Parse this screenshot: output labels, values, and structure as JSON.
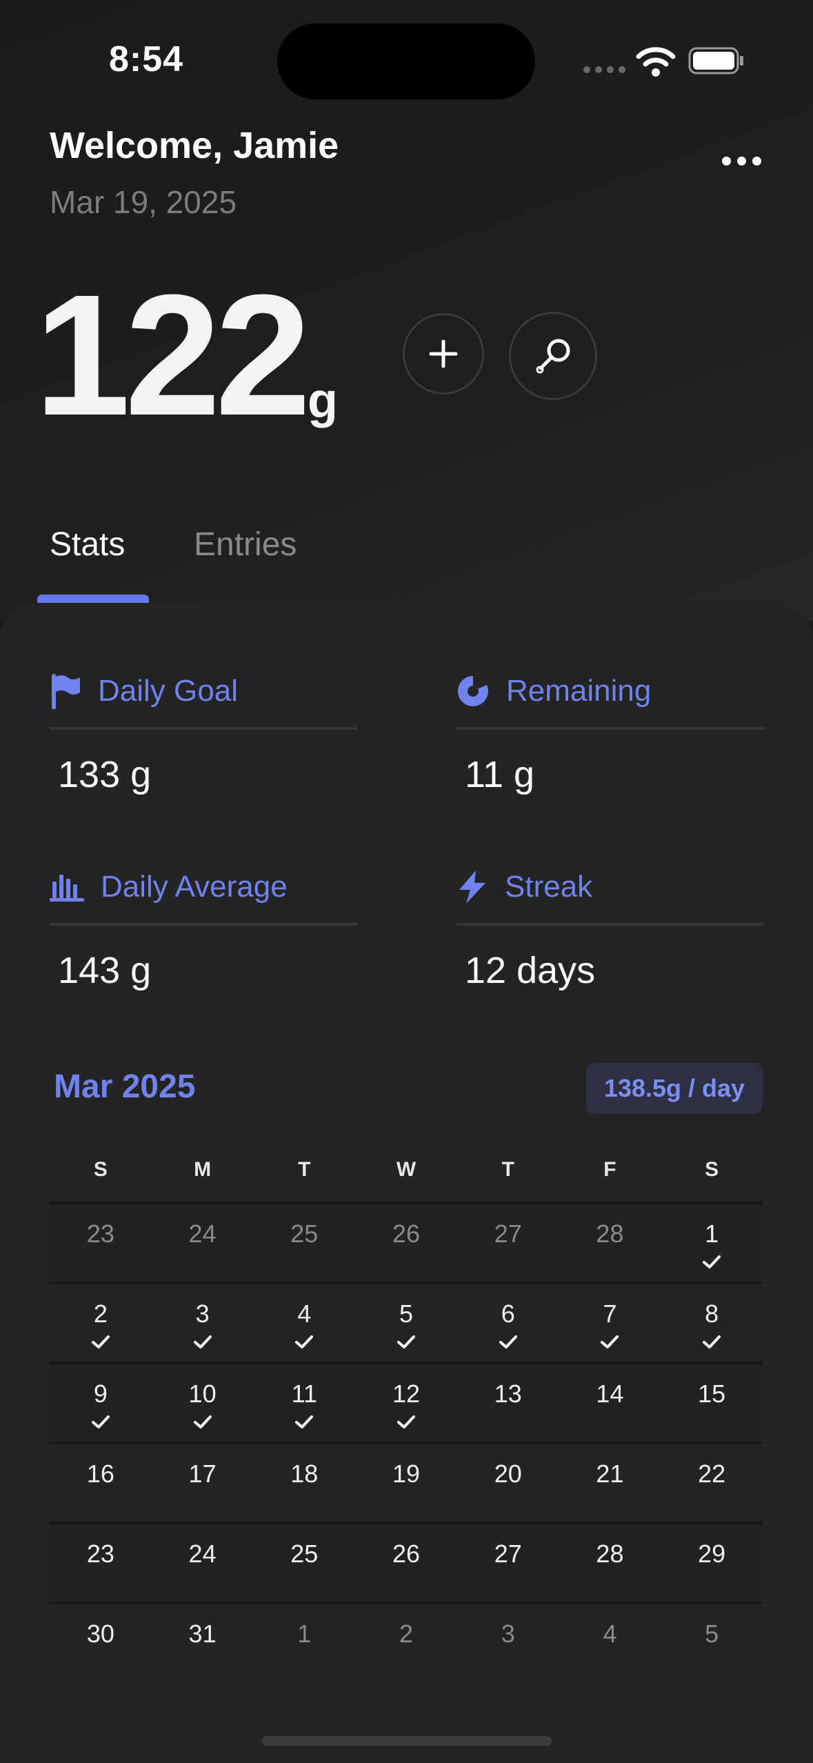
{
  "status_bar": {
    "time": "8:54"
  },
  "header": {
    "welcome": "Welcome, Jamie",
    "date": "Mar 19, 2025"
  },
  "total": {
    "value": "122",
    "unit": "g"
  },
  "tabs": [
    {
      "label": "Stats",
      "active": true
    },
    {
      "label": "Entries",
      "active": false
    }
  ],
  "stats": [
    {
      "label": "Daily Goal",
      "value": "133 g",
      "icon": "flag-icon"
    },
    {
      "label": "Remaining",
      "value": "11 g",
      "icon": "pie-icon"
    },
    {
      "label": "Daily Average",
      "value": "143 g",
      "icon": "bar-chart-icon"
    },
    {
      "label": "Streak",
      "value": "12 days",
      "icon": "lightning-icon"
    }
  ],
  "calendar": {
    "month": "Mar 2025",
    "badge": "138.5g / day",
    "weekdays": [
      "S",
      "M",
      "T",
      "W",
      "T",
      "F",
      "S"
    ],
    "weeks": [
      [
        {
          "d": "23",
          "muted": true
        },
        {
          "d": "24",
          "muted": true
        },
        {
          "d": "25",
          "muted": true
        },
        {
          "d": "26",
          "muted": true
        },
        {
          "d": "27",
          "muted": true
        },
        {
          "d": "28",
          "muted": true
        },
        {
          "d": "1",
          "check": true
        }
      ],
      [
        {
          "d": "2",
          "check": true
        },
        {
          "d": "3",
          "check": true
        },
        {
          "d": "4",
          "check": true
        },
        {
          "d": "5",
          "check": true
        },
        {
          "d": "6",
          "check": true
        },
        {
          "d": "7",
          "check": true
        },
        {
          "d": "8",
          "check": true
        }
      ],
      [
        {
          "d": "9",
          "check": true
        },
        {
          "d": "10",
          "check": true
        },
        {
          "d": "11",
          "check": true
        },
        {
          "d": "12",
          "check": true
        },
        {
          "d": "13"
        },
        {
          "d": "14"
        },
        {
          "d": "15"
        }
      ],
      [
        {
          "d": "16"
        },
        {
          "d": "17"
        },
        {
          "d": "18"
        },
        {
          "d": "19"
        },
        {
          "d": "20"
        },
        {
          "d": "21"
        },
        {
          "d": "22"
        }
      ],
      [
        {
          "d": "23"
        },
        {
          "d": "24"
        },
        {
          "d": "25"
        },
        {
          "d": "26"
        },
        {
          "d": "27"
        },
        {
          "d": "28"
        },
        {
          "d": "29"
        }
      ],
      [
        {
          "d": "30"
        },
        {
          "d": "31"
        },
        {
          "d": "1",
          "muted": true
        },
        {
          "d": "2",
          "muted": true
        },
        {
          "d": "3",
          "muted": true
        },
        {
          "d": "4",
          "muted": true
        },
        {
          "d": "5",
          "muted": true
        }
      ]
    ]
  },
  "colors": {
    "accent": "#6f82ee",
    "background": "#1c1c1c",
    "card": "#242424",
    "badge_bg": "#2d2f43"
  }
}
